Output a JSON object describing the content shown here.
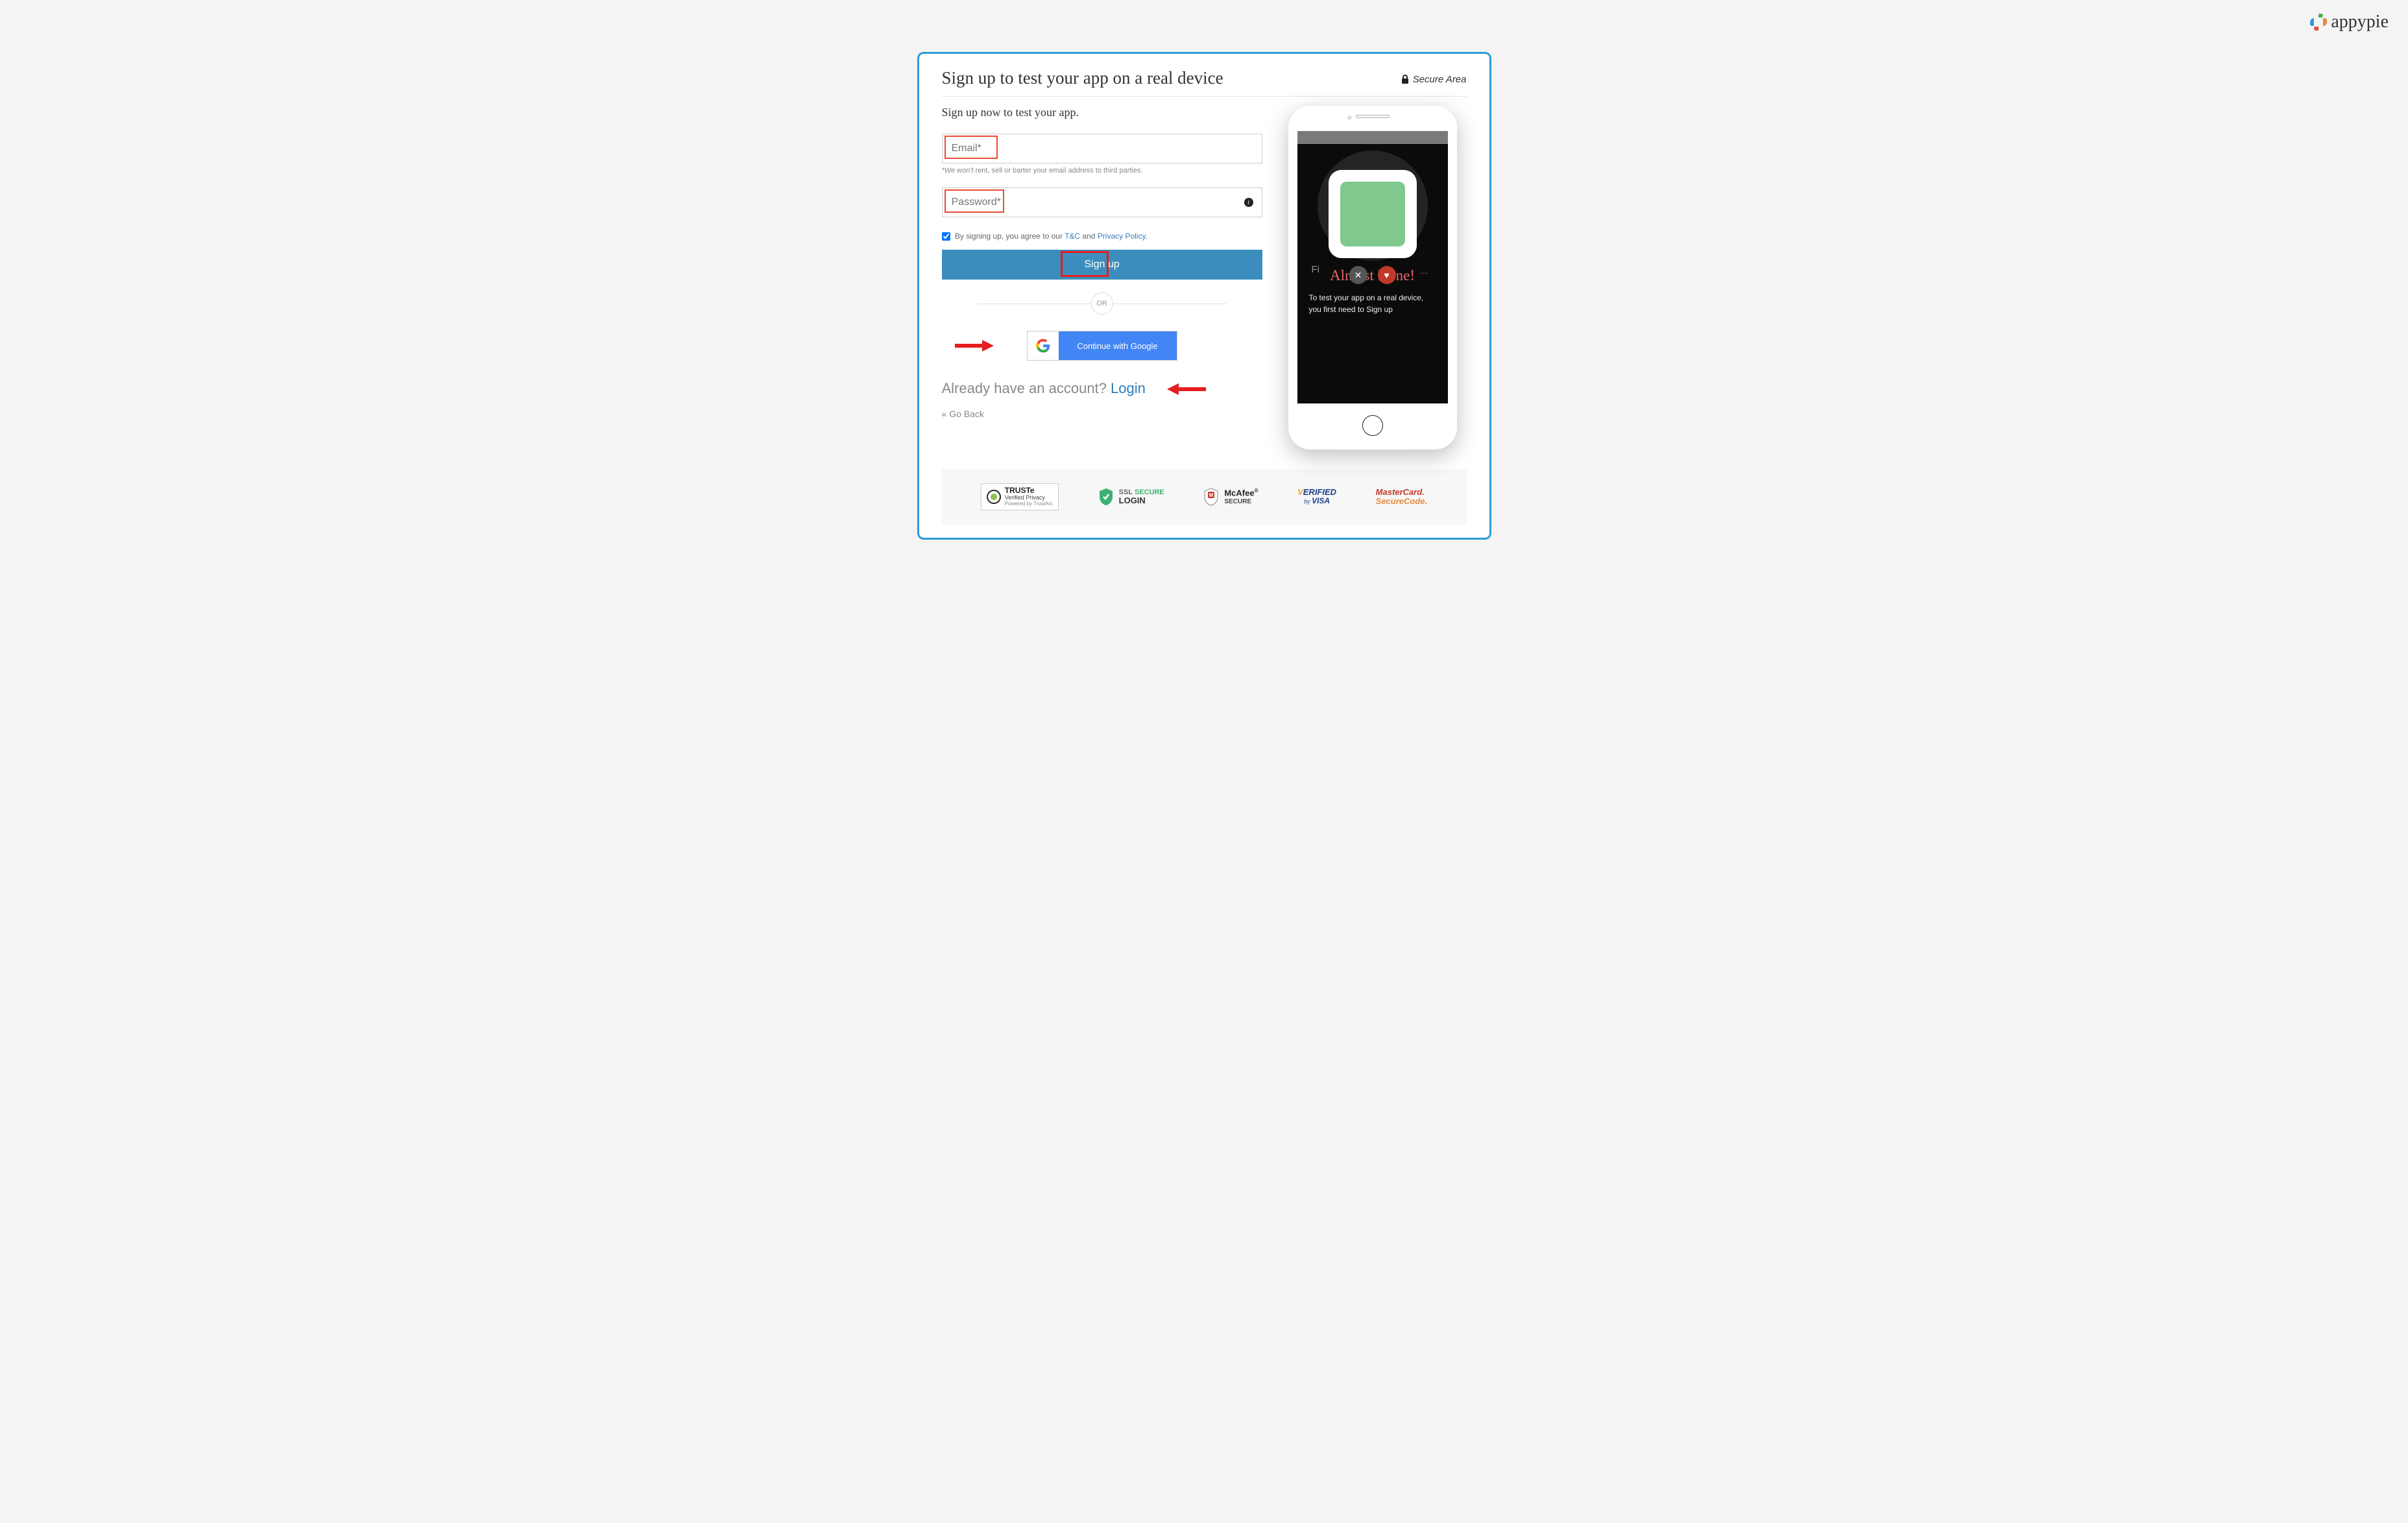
{
  "brand": {
    "name": "appypie"
  },
  "header": {
    "title": "Sign up to test your app on a real device",
    "secure_area": "Secure Area"
  },
  "form": {
    "subtitle": "Sign up now to test your app.",
    "email_placeholder": "Email*",
    "email_helper_prefix": "*We won't ",
    "email_helper_mid": "rent, sell or barter your email ",
    "email_helper_suffix": "address to third parties.",
    "password_placeholder": "Password*",
    "consent_prefix": "By signing up, you agree to our ",
    "consent_tc": "T&C",
    "consent_and": " and ",
    "consent_privacy": "Privacy Policy",
    "signup_label": "Sign up",
    "or_label": "OR",
    "google_label": "Continue with Google",
    "login_prompt": "Already have an account? ",
    "login_link": "Login",
    "go_back": "« Go Back"
  },
  "phone": {
    "almost_done": "Almost Done!",
    "subtext_l1": "To test your app on a real device,",
    "subtext_l2": "you first need to Sign up",
    "bg_text": "Fi"
  },
  "badges": {
    "truste_title": "TRUSTe",
    "truste_sub": "Verified Privacy",
    "truste_powered": "Powered by TrustArc",
    "ssl_l1": "SSL SECURE",
    "ssl_l2": "LOGIN",
    "mcafee_l1": "McAfee",
    "mcafee_l2": "SECURE",
    "visa_l1": "VERIFIED",
    "visa_l2": "by VISA",
    "mc_l1": "MasterCard.",
    "mc_l2": "SecureCode."
  }
}
